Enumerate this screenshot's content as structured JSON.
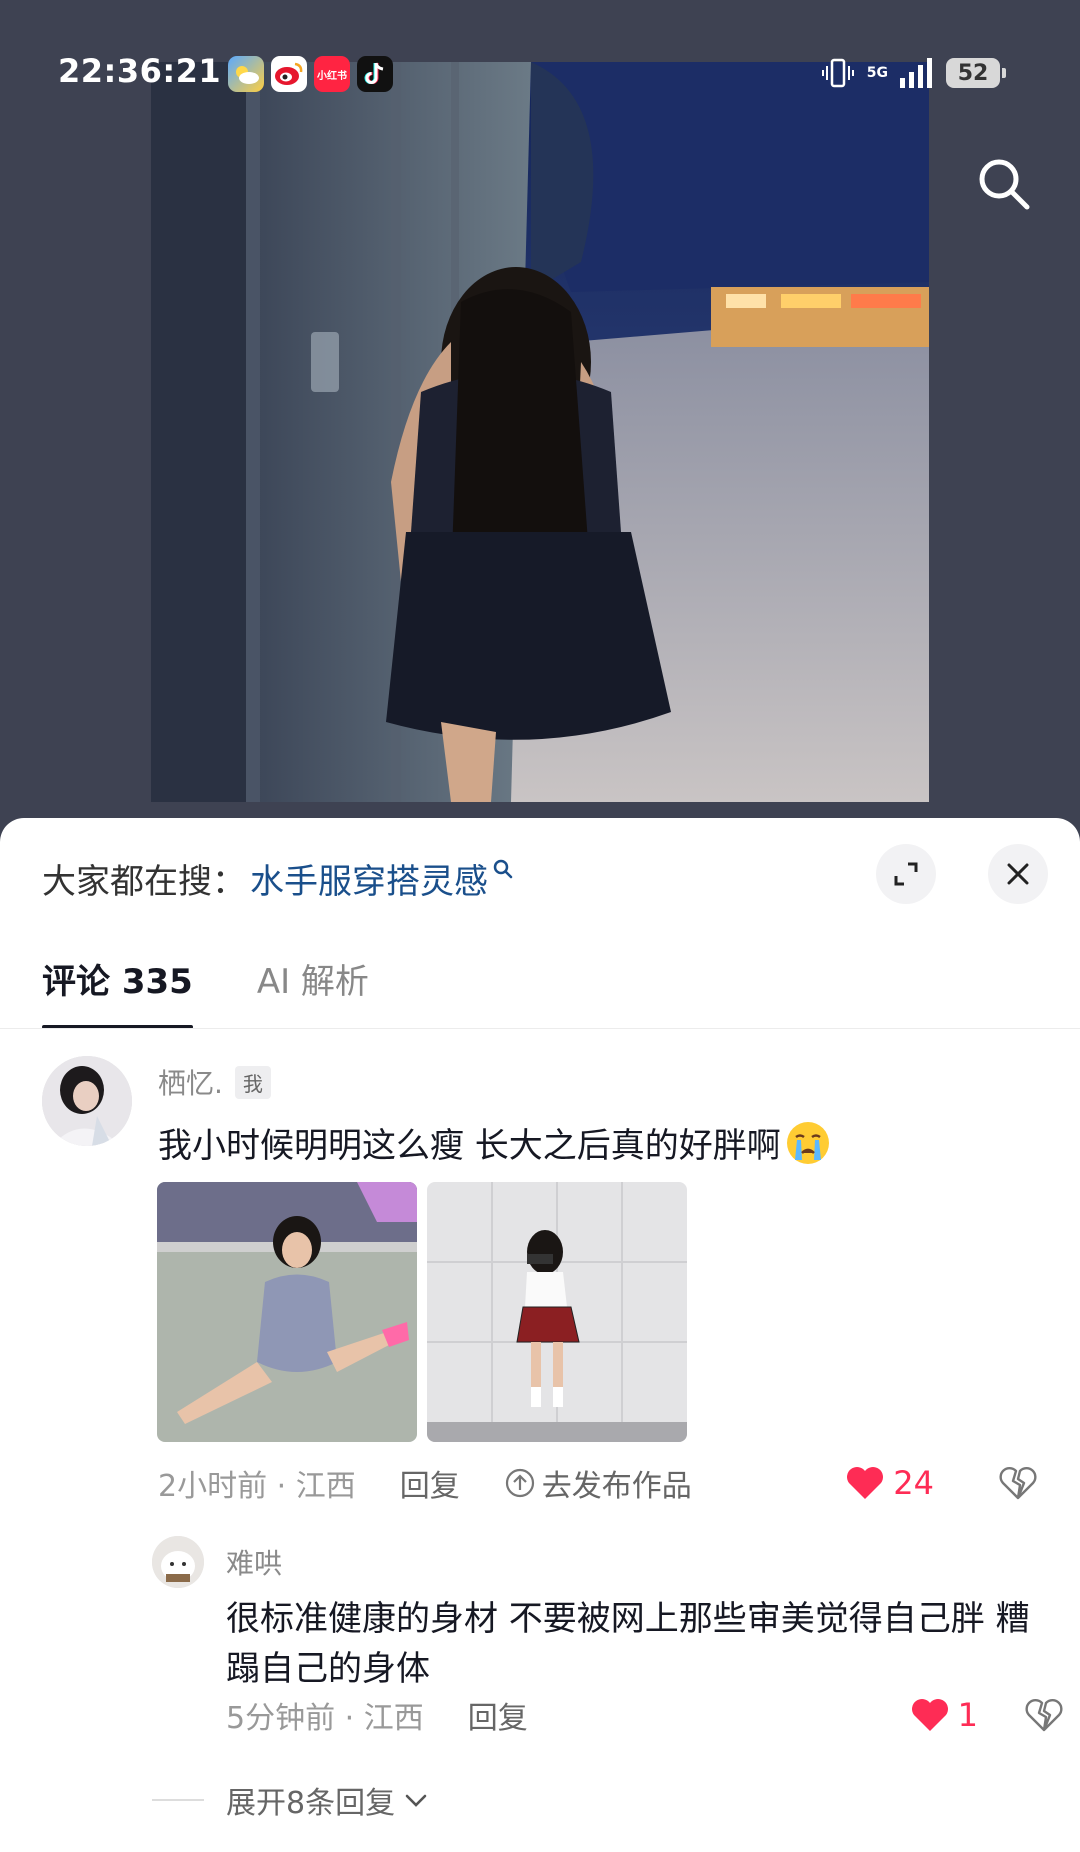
{
  "status_bar": {
    "time": "22:36:21",
    "apps": [
      {
        "name": "weather-app-icon"
      },
      {
        "name": "weibo-app-icon"
      },
      {
        "name": "xiaohongshu-app-icon",
        "label": "小红书"
      },
      {
        "name": "tiktok-app-icon"
      }
    ],
    "network": "5G",
    "battery": "52"
  },
  "sheet": {
    "trending_prefix": "大家都在搜：",
    "trending_query": "水手服穿搭灵感",
    "tabs": [
      {
        "label": "评论 335",
        "active": true
      },
      {
        "label": "AI 解析",
        "active": false
      }
    ]
  },
  "comment": {
    "username": "栖忆.",
    "badge": "我",
    "text": "我小时候明明这么瘦 长大之后真的好胖啊",
    "time_location": "2小时前 · 江西",
    "reply_label": "回复",
    "publish_label": "去发布作品",
    "likes": "24"
  },
  "reply": {
    "username": "难哄",
    "text": "很标准健康的身材 不要被网上那些审美觉得自己胖 糟蹋自己的身体",
    "time_location": "5分钟前 · 江西",
    "reply_label": "回复",
    "likes": "1"
  },
  "expand_replies": "展开8条回复",
  "colors": {
    "background": "#3e4252",
    "like": "#fe2c55",
    "link": "#1a4f8b"
  }
}
